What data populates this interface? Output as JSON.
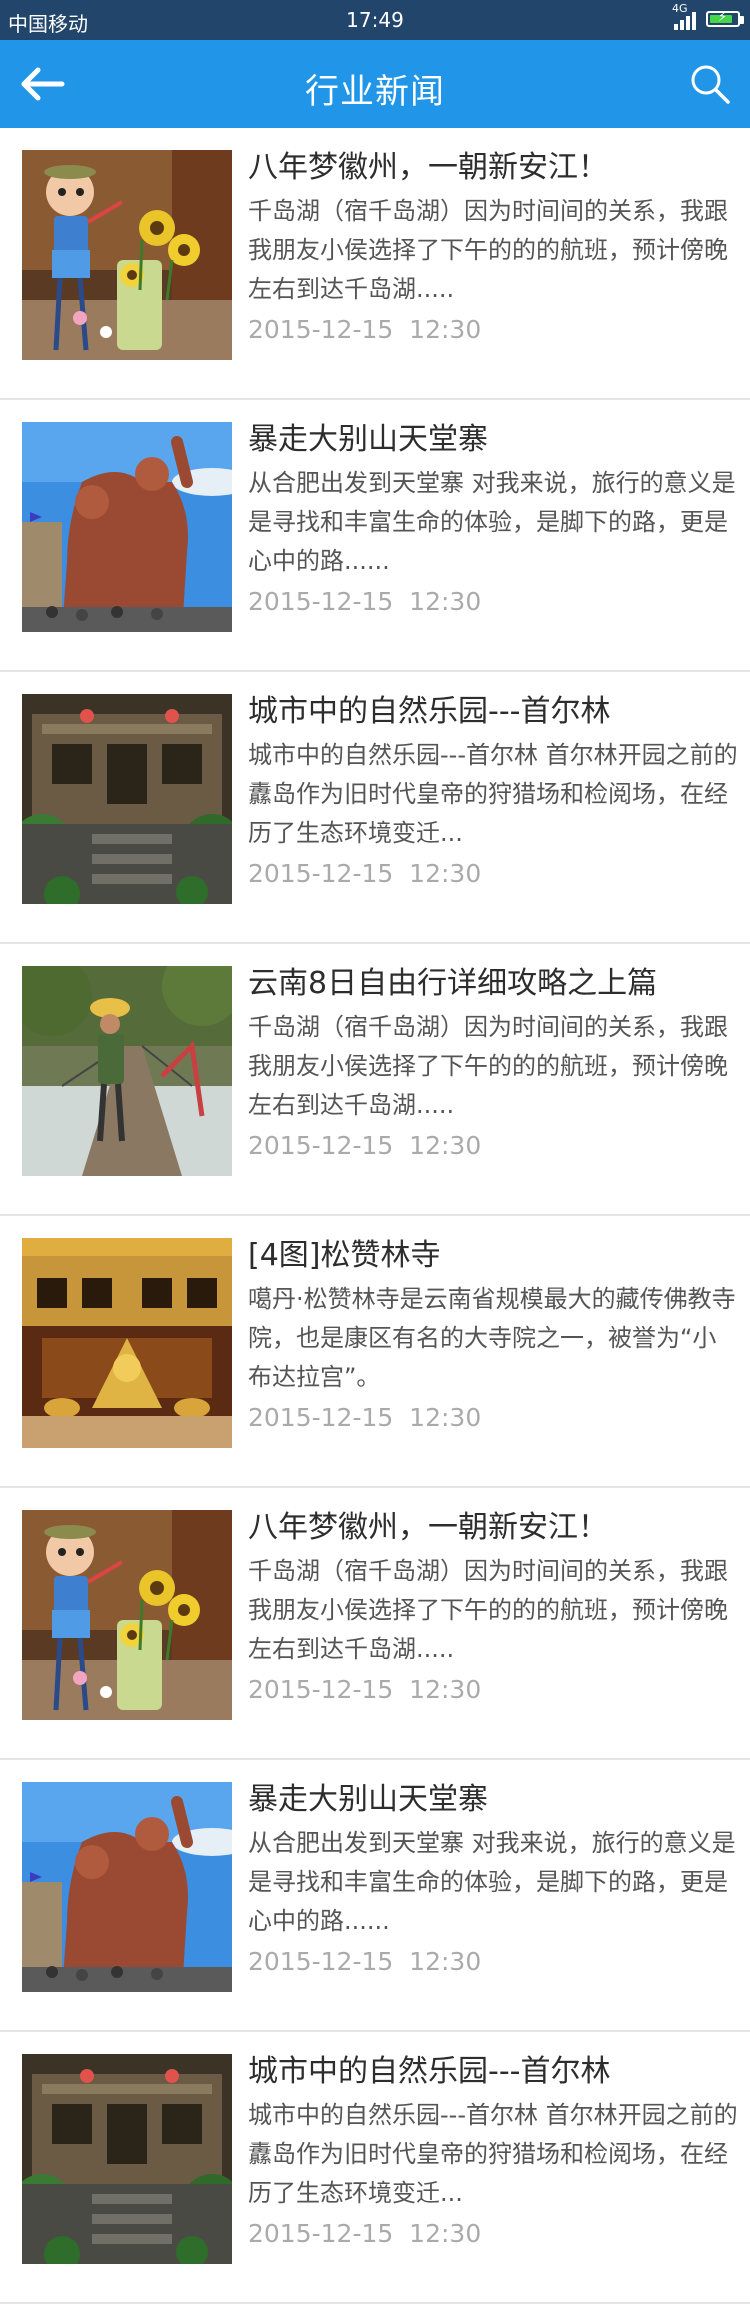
{
  "status_bar": {
    "carrier": "中国移动",
    "time": "17:49",
    "network": "4G",
    "battery_level": 0.85
  },
  "nav": {
    "title": "行业新闻",
    "back_icon": "arrow-left-icon",
    "search_icon": "search-icon"
  },
  "colors": {
    "status_bar": "#22466b",
    "nav_bar": "#2196e8",
    "title_text": "#2d2d2d",
    "summary_text": "#555555",
    "date_text": "#aaaaaa"
  },
  "news": [
    {
      "image": "doll-sunflower-photo",
      "title": "八年梦徽州，一朝新安江！",
      "summary": "千岛湖（宿千岛湖）因为时间间的关系，我跟我朋友小侯选择了下午的的的航班，预计傍晚左右到达千岛湖.....",
      "date": "2015-12-15  12:30"
    },
    {
      "image": "statue-sky-photo",
      "title": "暴走大别山天堂寨",
      "summary": "从合肥出发到天堂寨 对我来说，旅行的意义是是寻找和丰富生命的体验，是脚下的路，更是心中的路......",
      "date": "2015-12-15  12:30"
    },
    {
      "image": "garden-house-photo",
      "title": "城市中的自然乐园---首尔林",
      "summary": "城市中的自然乐园---首尔林 首尔林开园之前的纛岛作为旧时代皇帝的狩猎场和检阅场，在经历了生态环境变迁...",
      "date": "2015-12-15  12:30"
    },
    {
      "image": "bridge-hiker-photo",
      "title": "云南8日自由行详细攻略之上篇",
      "summary": "千岛湖（宿千岛湖）因为时间间的关系，我跟我朋友小侯选择了下午的的的航班，预计傍晚左右到达千岛湖.....",
      "date": "2015-12-15  12:30"
    },
    {
      "image": "golden-temple-photo",
      "title": "[4图]松赞林寺",
      "summary": "噶丹·松赞林寺是云南省规模最大的藏传佛教寺院，也是康区有名的大寺院之一，被誉为“小布达拉宫”。",
      "date": "2015-12-15  12:30"
    },
    {
      "image": "doll-sunflower-photo",
      "title": "八年梦徽州，一朝新安江！",
      "summary": "千岛湖（宿千岛湖）因为时间间的关系，我跟我朋友小侯选择了下午的的的航班，预计傍晚左右到达千岛湖.....",
      "date": "2015-12-15  12:30"
    },
    {
      "image": "statue-sky-photo",
      "title": "暴走大别山天堂寨",
      "summary": "从合肥出发到天堂寨 对我来说，旅行的意义是是寻找和丰富生命的体验，是脚下的路，更是心中的路......",
      "date": "2015-12-15  12:30"
    },
    {
      "image": "garden-house-photo",
      "title": "城市中的自然乐园---首尔林",
      "summary": "城市中的自然乐园---首尔林 首尔林开园之前的纛岛作为旧时代皇帝的狩猎场和检阅场，在经历了生态环境变迁...",
      "date": "2015-12-15  12:30"
    }
  ]
}
